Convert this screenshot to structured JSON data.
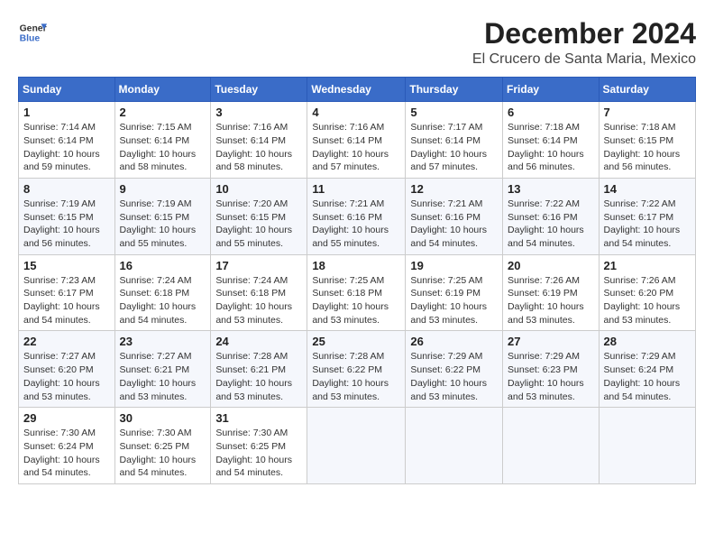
{
  "header": {
    "logo_line1": "General",
    "logo_line2": "Blue",
    "title": "December 2024",
    "subtitle": "El Crucero de Santa Maria, Mexico"
  },
  "calendar": {
    "days_of_week": [
      "Sunday",
      "Monday",
      "Tuesday",
      "Wednesday",
      "Thursday",
      "Friday",
      "Saturday"
    ],
    "weeks": [
      [
        {
          "day": "",
          "info": ""
        },
        {
          "day": "2",
          "info": "Sunrise: 7:15 AM\nSunset: 6:14 PM\nDaylight: 10 hours\nand 58 minutes."
        },
        {
          "day": "3",
          "info": "Sunrise: 7:16 AM\nSunset: 6:14 PM\nDaylight: 10 hours\nand 58 minutes."
        },
        {
          "day": "4",
          "info": "Sunrise: 7:16 AM\nSunset: 6:14 PM\nDaylight: 10 hours\nand 57 minutes."
        },
        {
          "day": "5",
          "info": "Sunrise: 7:17 AM\nSunset: 6:14 PM\nDaylight: 10 hours\nand 57 minutes."
        },
        {
          "day": "6",
          "info": "Sunrise: 7:18 AM\nSunset: 6:14 PM\nDaylight: 10 hours\nand 56 minutes."
        },
        {
          "day": "7",
          "info": "Sunrise: 7:18 AM\nSunset: 6:15 PM\nDaylight: 10 hours\nand 56 minutes."
        }
      ],
      [
        {
          "day": "1",
          "info": "Sunrise: 7:14 AM\nSunset: 6:14 PM\nDaylight: 10 hours\nand 59 minutes."
        },
        {
          "day": "",
          "info": ""
        },
        {
          "day": "",
          "info": ""
        },
        {
          "day": "",
          "info": ""
        },
        {
          "day": "",
          "info": ""
        },
        {
          "day": "",
          "info": ""
        },
        {
          "day": "",
          "info": ""
        }
      ],
      [
        {
          "day": "8",
          "info": "Sunrise: 7:19 AM\nSunset: 6:15 PM\nDaylight: 10 hours\nand 56 minutes."
        },
        {
          "day": "9",
          "info": "Sunrise: 7:19 AM\nSunset: 6:15 PM\nDaylight: 10 hours\nand 55 minutes."
        },
        {
          "day": "10",
          "info": "Sunrise: 7:20 AM\nSunset: 6:15 PM\nDaylight: 10 hours\nand 55 minutes."
        },
        {
          "day": "11",
          "info": "Sunrise: 7:21 AM\nSunset: 6:16 PM\nDaylight: 10 hours\nand 55 minutes."
        },
        {
          "day": "12",
          "info": "Sunrise: 7:21 AM\nSunset: 6:16 PM\nDaylight: 10 hours\nand 54 minutes."
        },
        {
          "day": "13",
          "info": "Sunrise: 7:22 AM\nSunset: 6:16 PM\nDaylight: 10 hours\nand 54 minutes."
        },
        {
          "day": "14",
          "info": "Sunrise: 7:22 AM\nSunset: 6:17 PM\nDaylight: 10 hours\nand 54 minutes."
        }
      ],
      [
        {
          "day": "15",
          "info": "Sunrise: 7:23 AM\nSunset: 6:17 PM\nDaylight: 10 hours\nand 54 minutes."
        },
        {
          "day": "16",
          "info": "Sunrise: 7:24 AM\nSunset: 6:18 PM\nDaylight: 10 hours\nand 54 minutes."
        },
        {
          "day": "17",
          "info": "Sunrise: 7:24 AM\nSunset: 6:18 PM\nDaylight: 10 hours\nand 53 minutes."
        },
        {
          "day": "18",
          "info": "Sunrise: 7:25 AM\nSunset: 6:18 PM\nDaylight: 10 hours\nand 53 minutes."
        },
        {
          "day": "19",
          "info": "Sunrise: 7:25 AM\nSunset: 6:19 PM\nDaylight: 10 hours\nand 53 minutes."
        },
        {
          "day": "20",
          "info": "Sunrise: 7:26 AM\nSunset: 6:19 PM\nDaylight: 10 hours\nand 53 minutes."
        },
        {
          "day": "21",
          "info": "Sunrise: 7:26 AM\nSunset: 6:20 PM\nDaylight: 10 hours\nand 53 minutes."
        }
      ],
      [
        {
          "day": "22",
          "info": "Sunrise: 7:27 AM\nSunset: 6:20 PM\nDaylight: 10 hours\nand 53 minutes."
        },
        {
          "day": "23",
          "info": "Sunrise: 7:27 AM\nSunset: 6:21 PM\nDaylight: 10 hours\nand 53 minutes."
        },
        {
          "day": "24",
          "info": "Sunrise: 7:28 AM\nSunset: 6:21 PM\nDaylight: 10 hours\nand 53 minutes."
        },
        {
          "day": "25",
          "info": "Sunrise: 7:28 AM\nSunset: 6:22 PM\nDaylight: 10 hours\nand 53 minutes."
        },
        {
          "day": "26",
          "info": "Sunrise: 7:29 AM\nSunset: 6:22 PM\nDaylight: 10 hours\nand 53 minutes."
        },
        {
          "day": "27",
          "info": "Sunrise: 7:29 AM\nSunset: 6:23 PM\nDaylight: 10 hours\nand 53 minutes."
        },
        {
          "day": "28",
          "info": "Sunrise: 7:29 AM\nSunset: 6:24 PM\nDaylight: 10 hours\nand 54 minutes."
        }
      ],
      [
        {
          "day": "29",
          "info": "Sunrise: 7:30 AM\nSunset: 6:24 PM\nDaylight: 10 hours\nand 54 minutes."
        },
        {
          "day": "30",
          "info": "Sunrise: 7:30 AM\nSunset: 6:25 PM\nDaylight: 10 hours\nand 54 minutes."
        },
        {
          "day": "31",
          "info": "Sunrise: 7:30 AM\nSunset: 6:25 PM\nDaylight: 10 hours\nand 54 minutes."
        },
        {
          "day": "",
          "info": ""
        },
        {
          "day": "",
          "info": ""
        },
        {
          "day": "",
          "info": ""
        },
        {
          "day": "",
          "info": ""
        }
      ]
    ]
  }
}
